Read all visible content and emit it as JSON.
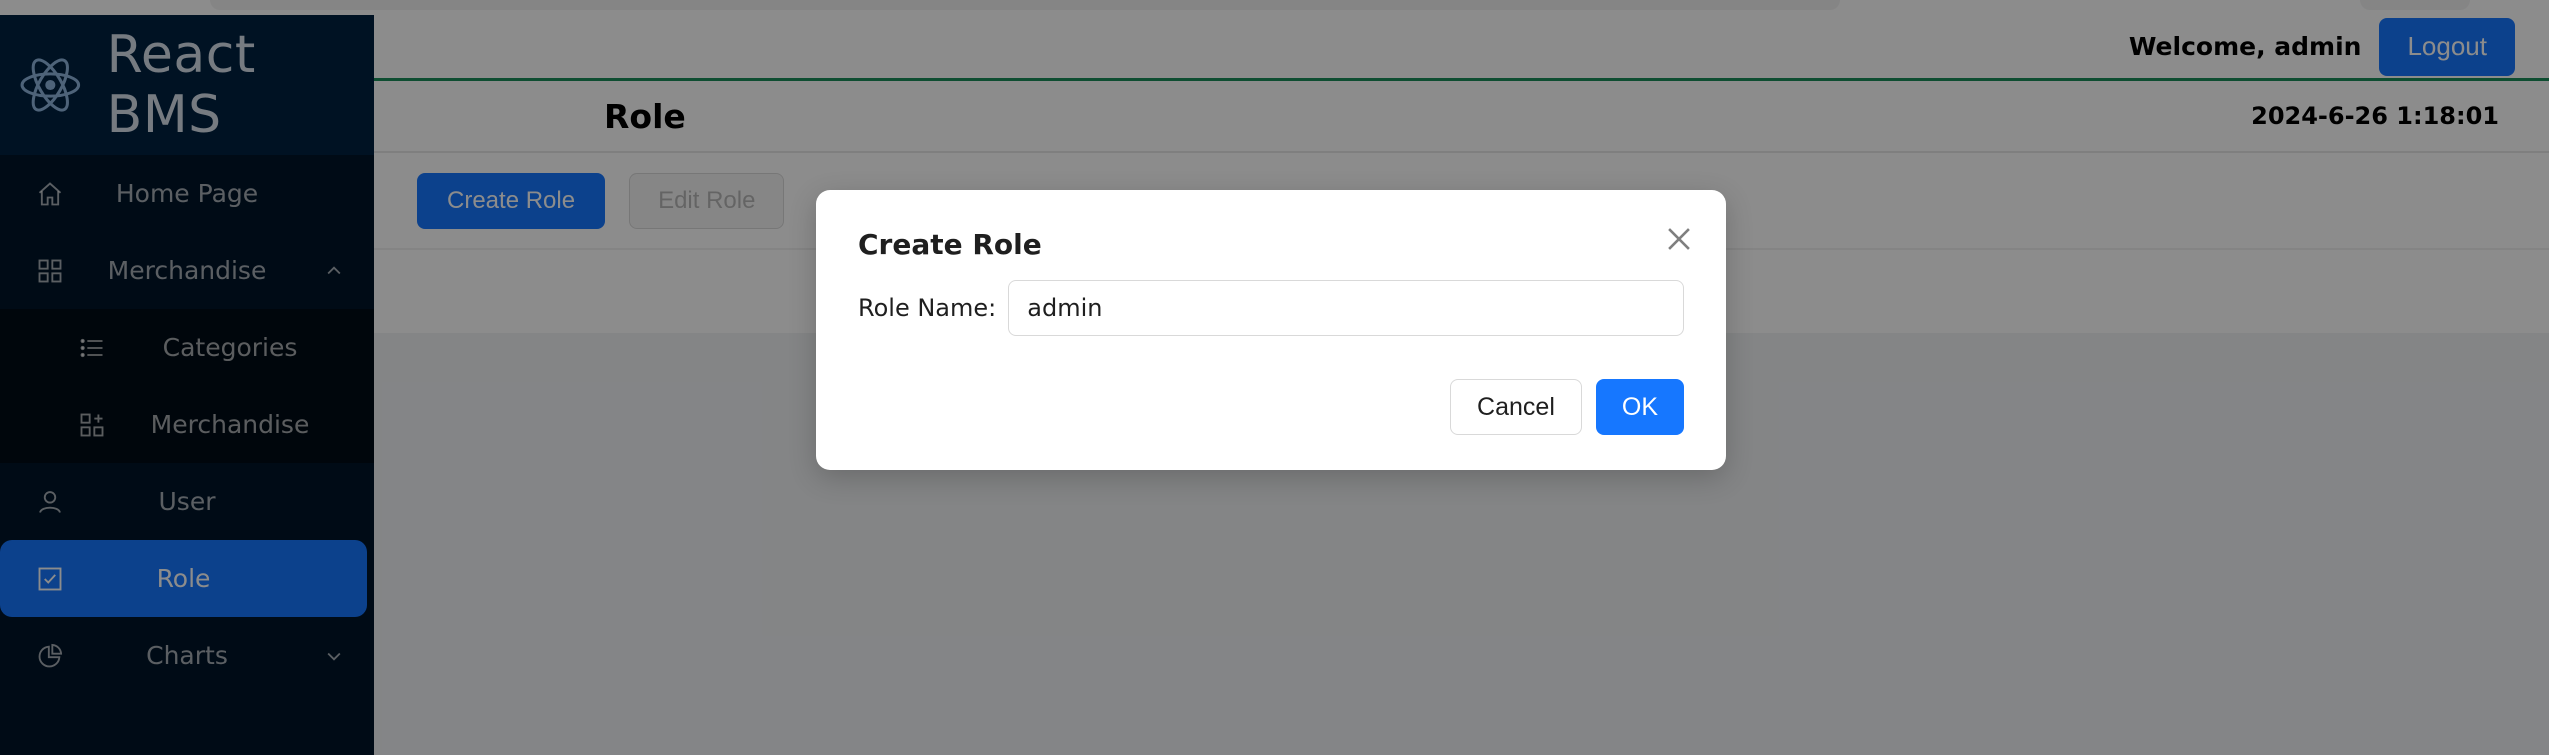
{
  "app": {
    "name": "React BMS",
    "logo_icon": "react-logo-icon"
  },
  "sidebar": {
    "items": [
      {
        "label": "Home Page",
        "icon": "home-icon"
      },
      {
        "label": "Merchandise",
        "icon": "appstore-icon",
        "expanded": true,
        "children": [
          {
            "label": "Categories",
            "icon": "bars-icon"
          },
          {
            "label": "Merchandise",
            "icon": "appstore-add-icon"
          }
        ]
      },
      {
        "label": "User",
        "icon": "user-icon"
      },
      {
        "label": "Role",
        "icon": "check-square-icon",
        "active": true
      },
      {
        "label": "Charts",
        "icon": "pie-chart-icon",
        "expanded": false
      }
    ]
  },
  "header": {
    "welcome": "Welcome, admin",
    "logout_label": "Logout"
  },
  "page": {
    "title": "Role",
    "datetime": "2024-6-26 1:18:01"
  },
  "toolbar": {
    "create_label": "Create Role",
    "edit_label": "Edit Role"
  },
  "modal": {
    "title": "Create Role",
    "field_label": "Role Name",
    "field_value": "admin",
    "cancel_label": "Cancel",
    "ok_label": "OK"
  },
  "colors": {
    "primary": "#1677ff",
    "sidebar_bg": "#001529",
    "header_border": "#1b8c5a"
  }
}
